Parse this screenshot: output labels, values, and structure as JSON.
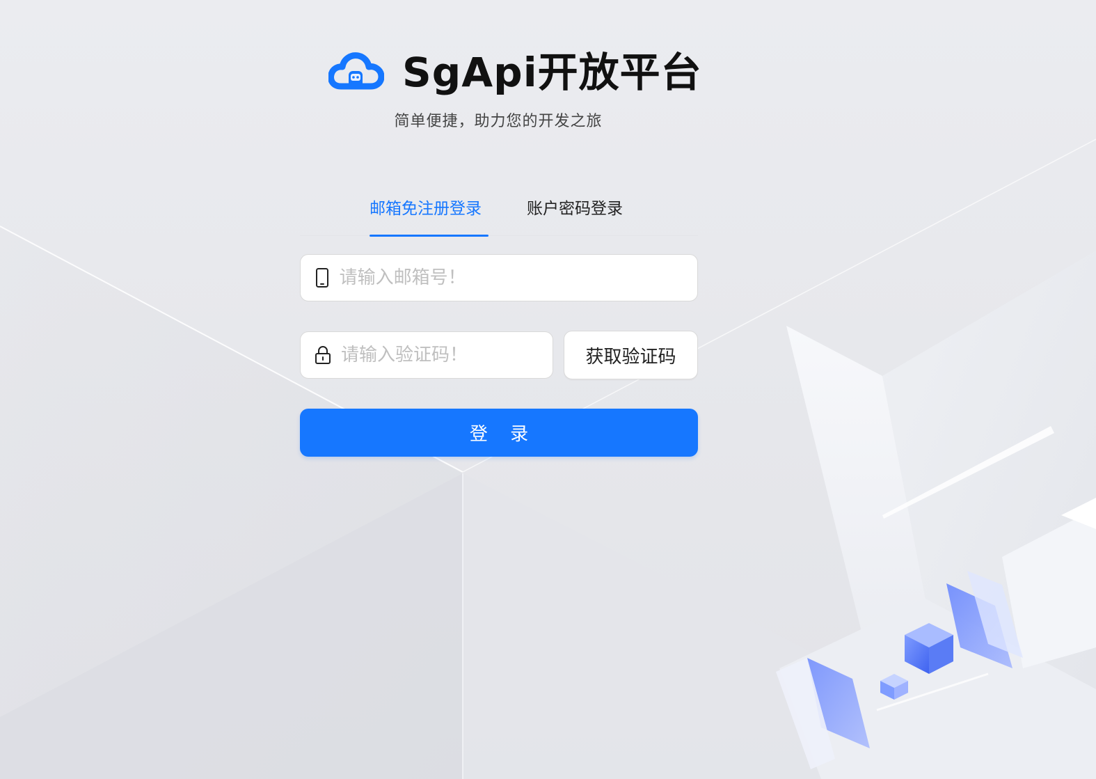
{
  "brand": {
    "title": "SgApi开放平台",
    "subtitle": "简单便捷，助力您的开发之旅",
    "logo_icon": "cloud-robot-logo-icon",
    "accent_color": "#1677ff"
  },
  "tabs": [
    {
      "label": "邮箱免注册登录",
      "active": true
    },
    {
      "label": "账户密码登录",
      "active": false
    }
  ],
  "form": {
    "email": {
      "icon": "mobile-phone-icon",
      "placeholder": "请输入邮箱号！",
      "value": ""
    },
    "code": {
      "icon": "lock-icon",
      "placeholder": "请输入验证码！",
      "value": ""
    },
    "get_code_label": "获取验证码",
    "login_label": "登 录"
  }
}
